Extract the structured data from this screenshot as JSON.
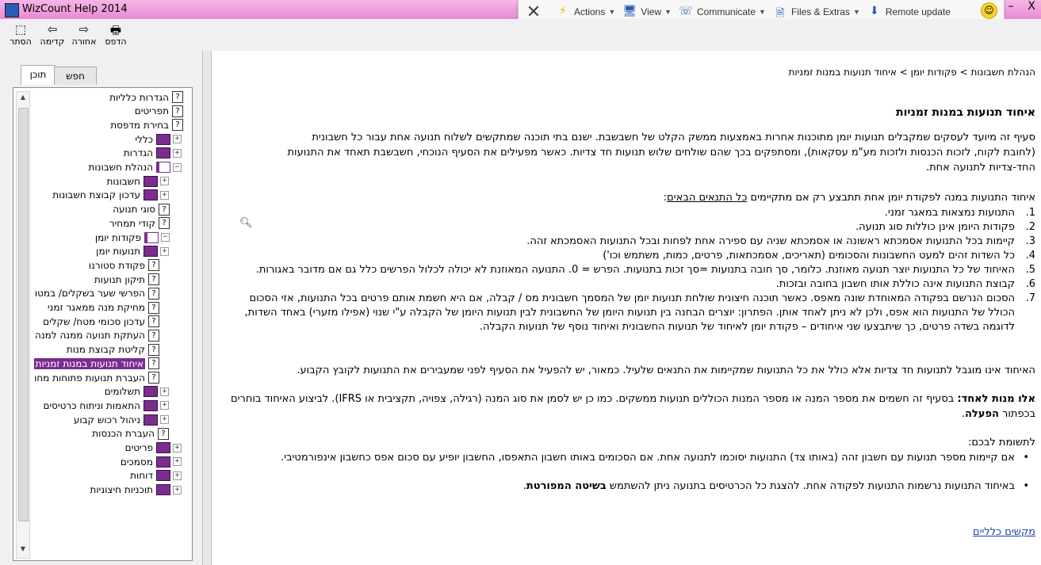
{
  "window": {
    "title": "WizCount Help 2014",
    "minimize": "–",
    "close": "X"
  },
  "remote_bar": {
    "close": "✕",
    "items": [
      {
        "icon": "lightning-icon",
        "glyph": "⚡",
        "label": "Actions"
      },
      {
        "icon": "monitor-icon",
        "glyph": "🖥",
        "label": "View"
      },
      {
        "icon": "chat-icon",
        "glyph": "☏",
        "label": "Communicate"
      },
      {
        "icon": "files-icon",
        "glyph": "🗎",
        "label": "Files & Extras"
      },
      {
        "icon": "download-icon",
        "glyph": "⬇",
        "label": "Remote update"
      }
    ],
    "smiley": "☺",
    "mini": "▦ ⤢ ⌃"
  },
  "toolbar": {
    "hide": {
      "label": "הסתר",
      "glyph": "⬚"
    },
    "back": {
      "label": "קדימה",
      "glyph": "⇦"
    },
    "forward": {
      "label": "אחורה",
      "glyph": "⇨"
    },
    "print": {
      "label": "הדפס",
      "glyph": "🖶"
    }
  },
  "tabs": {
    "contents": "תוכן",
    "search": "חפש"
  },
  "tree": [
    {
      "label": "הגדרות כלליות",
      "kind": "q"
    },
    {
      "label": "תפריטים",
      "kind": "q"
    },
    {
      "label": "בחירת מדפסת",
      "kind": "q"
    },
    {
      "label": "כללי",
      "kind": "book",
      "pm": "+"
    },
    {
      "label": "הגדרות",
      "kind": "book",
      "pm": "+"
    },
    {
      "label": "הנהלת חשבונות",
      "kind": "bookopen",
      "pm": "−"
    },
    {
      "label": "חשבונות",
      "kind": "book",
      "pm": "+"
    },
    {
      "label": "עדכון קבוצת חשבונות",
      "kind": "book",
      "pm": "+"
    },
    {
      "label": "סוגי תנועה",
      "kind": "q"
    },
    {
      "label": "קודי תמחיר",
      "kind": "q"
    },
    {
      "label": "פקודות יומן",
      "kind": "bookopen",
      "pm": "−"
    },
    {
      "label": "תנועות יומן",
      "kind": "book",
      "pm": "+"
    },
    {
      "label": "פקודת סטורנו",
      "kind": "q"
    },
    {
      "label": "תיקון תנועות",
      "kind": "q"
    },
    {
      "label": "הפרשי שער בשקלים/ במטו",
      "kind": "q"
    },
    {
      "label": "מחיקת מנה ממאגר זמני",
      "kind": "q"
    },
    {
      "label": "עדכון סכומי מטח/ שקלים",
      "kind": "q"
    },
    {
      "label": "העתקת תנועה ממנה למנה",
      "kind": "q"
    },
    {
      "label": "קליטת קבוצת מנות",
      "kind": "q"
    },
    {
      "label": "איחוד תנועות במנות זמניות",
      "kind": "q",
      "selected": true
    },
    {
      "label": "העברת תנועות פתוחות מחו",
      "kind": "q"
    },
    {
      "label": "תשלומים",
      "kind": "book",
      "pm": "+"
    },
    {
      "label": "התאמות וניתוח כרטיסים",
      "kind": "book",
      "pm": "+"
    },
    {
      "label": "ניהול רכוש קבוע",
      "kind": "book",
      "pm": "+"
    },
    {
      "label": "העברת הכנסות",
      "kind": "q"
    },
    {
      "label": "פריטים",
      "kind": "book",
      "pm": "+"
    },
    {
      "label": "מסמכים",
      "kind": "book",
      "pm": "+"
    },
    {
      "label": "דוחות",
      "kind": "book",
      "pm": "+"
    },
    {
      "label": "תוכניות חיצוניות",
      "kind": "book",
      "pm": "+"
    }
  ],
  "content": {
    "breadcrumb": "הנהלת חשבונות > פקודות יומן > איחוד תנועות במנות זמניות",
    "title": "איחוד תנועות במנות זמניות",
    "intro": [
      "סעיף זה מיועד לעסקים שמקבלים תנועות יומן מתוכנות אחרות באמצעות ממשק הקלט של חשבשבת. ישנם בתי תוכנה שמתקשים לשלוח תנועה אחת עבור כל חשבונית",
      "(לחובת לקוח, לזכות הכנסות ולזכות מע\"מ עסקאות), ומסתפקים בכך שהם שולחים שלוש תנועות חד צדיות. כאשר מפעילים את הסעיף הנוכחי, חשבשבת תאחד את התנועות",
      "החד-צדיות לתנועה אחת."
    ],
    "cond_intro": "איחוד התנועות במנה לפקודת יומן אחת תתבצע רק אם מתקיימים ",
    "cond_intro_u": "כל התנאים הבאים",
    "cond_intro_end": ":",
    "conditions": [
      {
        "n": "1.",
        "t": "התנועות נמצאות במאגר זמני."
      },
      {
        "n": "2.",
        "t": "פקודות היומן אינן כוללות סוג תנועה."
      },
      {
        "n": "3.",
        "t": "קיימות בכל התנועות אסמכתא ראשונה או אסמכתא שניה עם ספירה אחת לפחות ובכל התנועות האסמכתא זהה."
      },
      {
        "n": "4.",
        "t": "כל השדות זהים למעט החשבונות והסכומים (תאריכים, אסמכתאות, פרטים, כמות, משתמש וכו')"
      },
      {
        "n": "5.",
        "t": "האיחוד של כל התנועות יוצר תנועה מאוזנת. כלומר, סך חובה בתנועות =סך זכות בתנועות. הפרש = 0. התנועה המאוזנת לא יכולה לכלול הפרשים כלל גם אם מדובר באגורות."
      },
      {
        "n": "6.",
        "t": "קבוצת התנועות אינה כוללת אותו חשבון בחובה ובזכות."
      },
      {
        "n": "7.",
        "t": "הסכום הנרשם בפקודה המאוחדת שונה מאפס. כאשר תוכנה חיצונית שולחת תנועות יומן של המסמך חשבונית מס / קבלה, אם היא חשמת אותם פרטים בכל התנועות, אזי הסכום הכולל של התנועות הוא אפס, ולכן לא ניתן לאחד אותן. הפתרון: יוצרים הבחנה בין תנועות היומן של החשבונית לבין תנועות היומן של הקבלה ע\"י שנוי (אפילו מזערי) באחד השדות, לדוגמה בשדה פרטים, כך שיתבצעו שני איחודים – פקודת יומן לאיחוד של תנועות החשבונית ואיחוד נוסף של תנועות הקבלה."
      }
    ],
    "after": "האיחוד אינו מוגבל לתנועות חד צדיות אלא כולל את כל התנועות שמקיימות את התנאים שלעיל. כמאור, יש להפעיל את הסעיף לפני שמעבירים את התנועות לקובץ הקבוע.",
    "non_unique_bold": "אלו מנות לאחד:",
    "non_unique": " בסעיף זה חשמים את מספר המנה או מספר המנות הכוללים תנועות ממשקים. כמו כן יש לסמן את סוג המנה (רגילה, צפויה, תקציבית או IFRS). לביצוע האיחוד בוחרים בכפתור ",
    "non_unique_btn": "הפעלה",
    "note_title": "לתשומת לבכם:",
    "bullets": [
      {
        "dot": "•",
        "t": "אם קיימות מספר תנועות עם חשבון זהה (באותו צד) התנועות יסוכמו לתנועה אחת. אם הסכומים באותו חשבון התאפסו, החשבון יופיע עם סכום אפס כחשבון אינפורמטיבי."
      },
      {
        "dot": "•",
        "t": "באיחוד התנועות נרשמות התנועות לפקודה אחת. להצגת כל הכרטיסים בתנועה ניתן להשתמש ",
        "b": "בשיטה המפורטת",
        "end": "."
      }
    ],
    "shortcuts_link": "מקשים כלליים",
    "magnifier": "🔍︎"
  }
}
